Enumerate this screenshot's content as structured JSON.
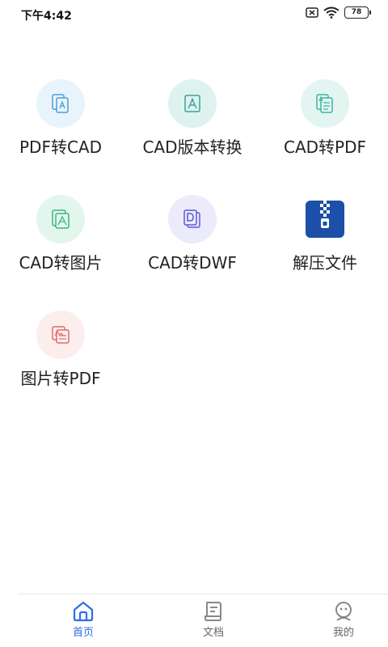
{
  "status_bar": {
    "time": "下午4:42",
    "battery": "78"
  },
  "tools": [
    {
      "label": "PDF转CAD",
      "icon": "pdf-to-cad-icon",
      "bg": "#e8f4fb",
      "fg": "#4a9ed8"
    },
    {
      "label": "CAD版本转换",
      "icon": "cad-version-icon",
      "bg": "#def2f0",
      "fg": "#3aa39a"
    },
    {
      "label": "CAD转PDF",
      "icon": "cad-to-pdf-icon",
      "bg": "#e2f5f1",
      "fg": "#3db59d"
    },
    {
      "label": "CAD转图片",
      "icon": "cad-to-image-icon",
      "bg": "#e3f6ee",
      "fg": "#3bb584"
    },
    {
      "label": "CAD转DWF",
      "icon": "cad-to-dwf-icon",
      "bg": "#ecebfb",
      "fg": "#5b5bd6"
    },
    {
      "label": "解压文件",
      "icon": "zip-file-icon",
      "bg": "#1b4fa8",
      "fg": "#ffffff"
    },
    {
      "label": "图片转PDF",
      "icon": "image-to-pdf-icon",
      "bg": "#fdeeee",
      "fg": "#e06a6a"
    }
  ],
  "nav": {
    "home": "首页",
    "docs": "文档",
    "mine": "我的"
  },
  "colors": {
    "accent": "#2b6ee8",
    "nav_inactive": "#666666"
  }
}
